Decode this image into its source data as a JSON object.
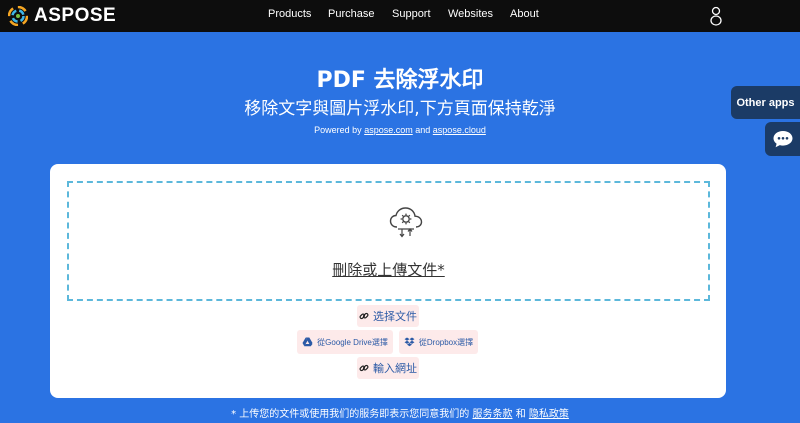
{
  "header": {
    "brand": "ASPOSE",
    "nav": [
      "Products",
      "Purchase",
      "Support",
      "Websites",
      "About"
    ]
  },
  "hero": {
    "title": "PDF 去除浮水印",
    "subtitle": "移除文字與圖片浮水印,下方頁面保持乾淨",
    "powered_prefix": "Powered by",
    "powered_link1": "aspose.com",
    "powered_and": "and",
    "powered_link2": "aspose.cloud"
  },
  "side": {
    "other_apps": "Other apps"
  },
  "upload": {
    "drop_label": "刪除或上傳文件*",
    "choose_file": "选择文件",
    "google_drive": "從Google Drive選擇",
    "dropbox": "從Dropbox選擇",
    "enter_url": "輸入網址"
  },
  "terms": {
    "prefix": "* 上传您的文件或使用我们的服务即表示您同意我们的",
    "tos": "服务条款",
    "and": "和",
    "privacy": "隐私政策"
  },
  "colors": {
    "background": "#2b73e3",
    "topbar": "#0d0d0d",
    "side_panel": "#1b3b66",
    "dropzone_border": "#5cb8db",
    "button_bg": "#fdeaea"
  }
}
